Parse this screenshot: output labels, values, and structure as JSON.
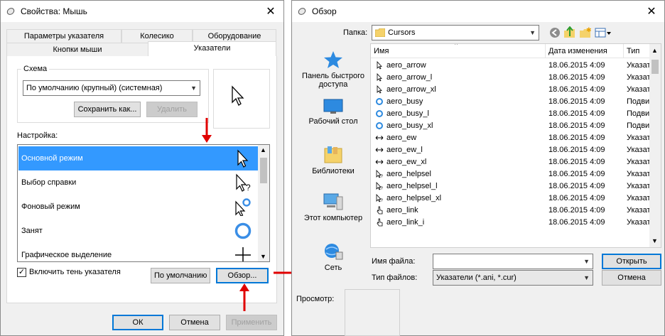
{
  "mouse_props": {
    "title": "Свойства: Мышь",
    "tabs_top": [
      "Параметры указателя",
      "Колесико",
      "Оборудование"
    ],
    "tabs_bottom": [
      "Кнопки мыши",
      "Указатели"
    ],
    "scheme_label": "Схема",
    "scheme_value": "По умолчанию (крупный) (системная)",
    "save_as_label": "Сохранить как...",
    "delete_label": "Удалить",
    "customize_label": "Настройка:",
    "cursor_items": [
      {
        "label": "Основной режим",
        "icon": "arrow-cursor-icon",
        "selected": true
      },
      {
        "label": "Выбор справки",
        "icon": "help-select-cursor-icon"
      },
      {
        "label": "Фоновый режим",
        "icon": "working-in-background-cursor-icon"
      },
      {
        "label": "Занят",
        "icon": "busy-cursor-icon"
      },
      {
        "label": "Графическое выделение",
        "icon": "precision-select-cursor-icon"
      }
    ],
    "shadow_label": "Включить тень указателя",
    "shadow_checked": true,
    "default_label": "По умолчанию",
    "browse_label": "Обзор...",
    "ok_label": "ОК",
    "cancel_label": "Отмена",
    "apply_label": "Применить"
  },
  "browse": {
    "title": "Обзор",
    "folder_label": "Папка:",
    "folder_value": "Cursors",
    "nav": [
      {
        "label": "Панель быстрого доступа",
        "icon": "star-icon"
      },
      {
        "label": "Рабочий стол",
        "icon": "desktop-icon"
      },
      {
        "label": "Библиотеки",
        "icon": "libraries-icon"
      },
      {
        "label": "Этот компьютер",
        "icon": "computer-icon"
      },
      {
        "label": "Сеть",
        "icon": "network-icon"
      }
    ],
    "columns": [
      "Имя",
      "Дата изменения",
      "Тип"
    ],
    "files": [
      {
        "name": "aero_arrow",
        "date": "18.06.2015 4:09",
        "type": "Указат",
        "icon": "arrow-icon"
      },
      {
        "name": "aero_arrow_l",
        "date": "18.06.2015 4:09",
        "type": "Указат",
        "icon": "arrow-icon"
      },
      {
        "name": "aero_arrow_xl",
        "date": "18.06.2015 4:09",
        "type": "Указат",
        "icon": "arrow-icon"
      },
      {
        "name": "aero_busy",
        "date": "18.06.2015 4:09",
        "type": "Подви",
        "icon": "busy-ring-icon"
      },
      {
        "name": "aero_busy_l",
        "date": "18.06.2015 4:09",
        "type": "Подви",
        "icon": "busy-ring-icon"
      },
      {
        "name": "aero_busy_xl",
        "date": "18.06.2015 4:09",
        "type": "Подви",
        "icon": "busy-ring-icon"
      },
      {
        "name": "aero_ew",
        "date": "18.06.2015 4:09",
        "type": "Указат",
        "icon": "resize-ew-icon"
      },
      {
        "name": "aero_ew_l",
        "date": "18.06.2015 4:09",
        "type": "Указат",
        "icon": "resize-ew-icon"
      },
      {
        "name": "aero_ew_xl",
        "date": "18.06.2015 4:09",
        "type": "Указат",
        "icon": "resize-ew-icon"
      },
      {
        "name": "aero_helpsel",
        "date": "18.06.2015 4:09",
        "type": "Указат",
        "icon": "help-arrow-icon"
      },
      {
        "name": "aero_helpsel_l",
        "date": "18.06.2015 4:09",
        "type": "Указат",
        "icon": "help-arrow-icon"
      },
      {
        "name": "aero_helpsel_xl",
        "date": "18.06.2015 4:09",
        "type": "Указат",
        "icon": "help-arrow-icon"
      },
      {
        "name": "aero_link",
        "date": "18.06.2015 4:09",
        "type": "Указат",
        "icon": "hand-icon"
      },
      {
        "name": "aero_link_i",
        "date": "18.06.2015 4:09",
        "type": "Указат",
        "icon": "hand-icon"
      }
    ],
    "filename_label": "Имя файла:",
    "filename_value": "",
    "filetype_label": "Тип файлов:",
    "filetype_value": "Указатели (*.ani, *.cur)",
    "open_label": "Открыть",
    "cancel_label": "Отмена",
    "preview_label": "Просмотр:"
  },
  "colors": {
    "accent": "#0078d7",
    "selection": "#3399ff",
    "red_arrow": "#e00000"
  }
}
